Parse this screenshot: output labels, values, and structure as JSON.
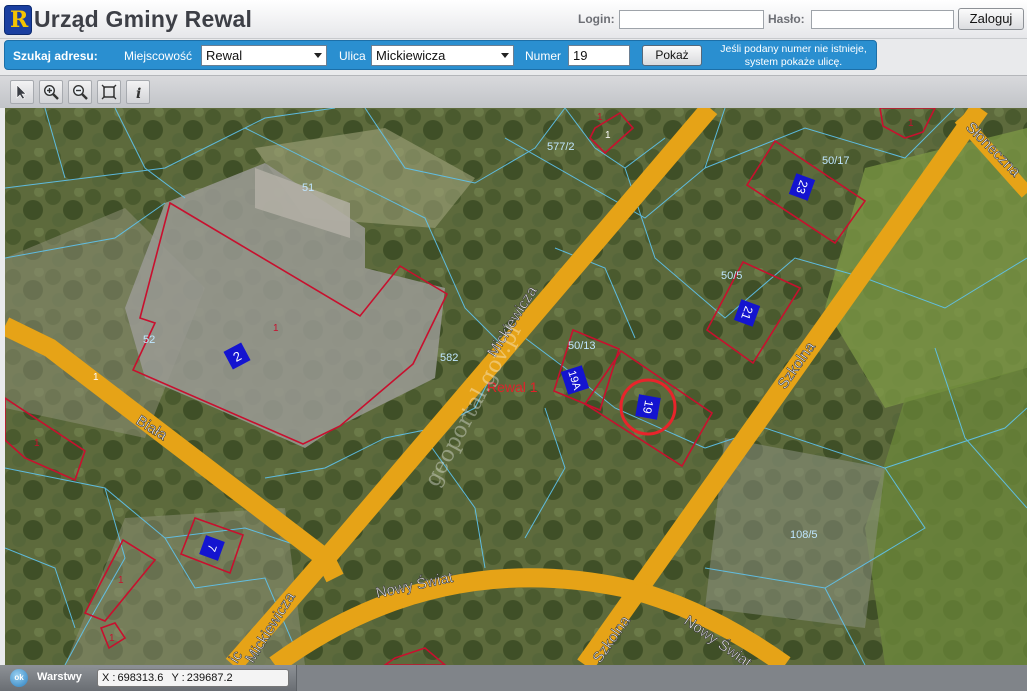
{
  "header": {
    "logo_letter": "R",
    "title": "Urząd Gminy Rewal",
    "login_label": "Login:",
    "login_value": "",
    "password_label": "Hasło:",
    "password_value": "",
    "login_button": "Zaloguj"
  },
  "search": {
    "label": "Szukaj adresu:",
    "town_label": "Miejscowość",
    "town_value": "Rewal",
    "street_label": "Ulica",
    "street_value": "Mickiewicza",
    "number_label": "Numer",
    "number_value": "19",
    "show_button": "Pokaż",
    "hint_line1": "Jeśli podany numer nie istnieje,",
    "hint_line2": "system pokaże ulicę."
  },
  "toolbar": {
    "tools": [
      "select-pointer-icon",
      "zoom-in-icon",
      "zoom-out-icon",
      "zoom-extent-icon",
      "info-icon"
    ],
    "info_glyph": "i"
  },
  "map": {
    "watermark": "geoportal.gov.pl",
    "area_label": "Rewal 1",
    "streets": {
      "mickiewicza": "Mickiewicza",
      "mickiewicza_lower": "Mickiewicza",
      "mickiewicza_edge": "ic",
      "biala": "Biała",
      "szkolna": "Szkolna",
      "szkolna_lower": "Szkolna",
      "nowy_swiat": "Nowy Świat",
      "nowy_swiat_right": "Nowy Świat",
      "sloneczna": "Słoneczna"
    },
    "parcels": [
      "51",
      "52",
      "582",
      "577/2",
      "50/17",
      "50/5",
      "50/13",
      "108/5"
    ],
    "buildings": [
      "2",
      "19A",
      "19",
      "21",
      "23",
      "7"
    ],
    "building_marks": [
      "1",
      "1",
      "1",
      "1",
      "1",
      "1",
      "1",
      "1"
    ],
    "colors": {
      "road": "#e6a317",
      "building_outline": "#c8102e",
      "parcel_line": "#5fc4f0",
      "building_number_bg": "#1414d0",
      "marker_circle": "#e8242b"
    }
  },
  "statusbar": {
    "ok_label": "ok",
    "layers_label": "Warstwy",
    "x_label": "X :",
    "x_value": "698313.6",
    "y_label": "Y :",
    "y_value": "239687.2"
  }
}
